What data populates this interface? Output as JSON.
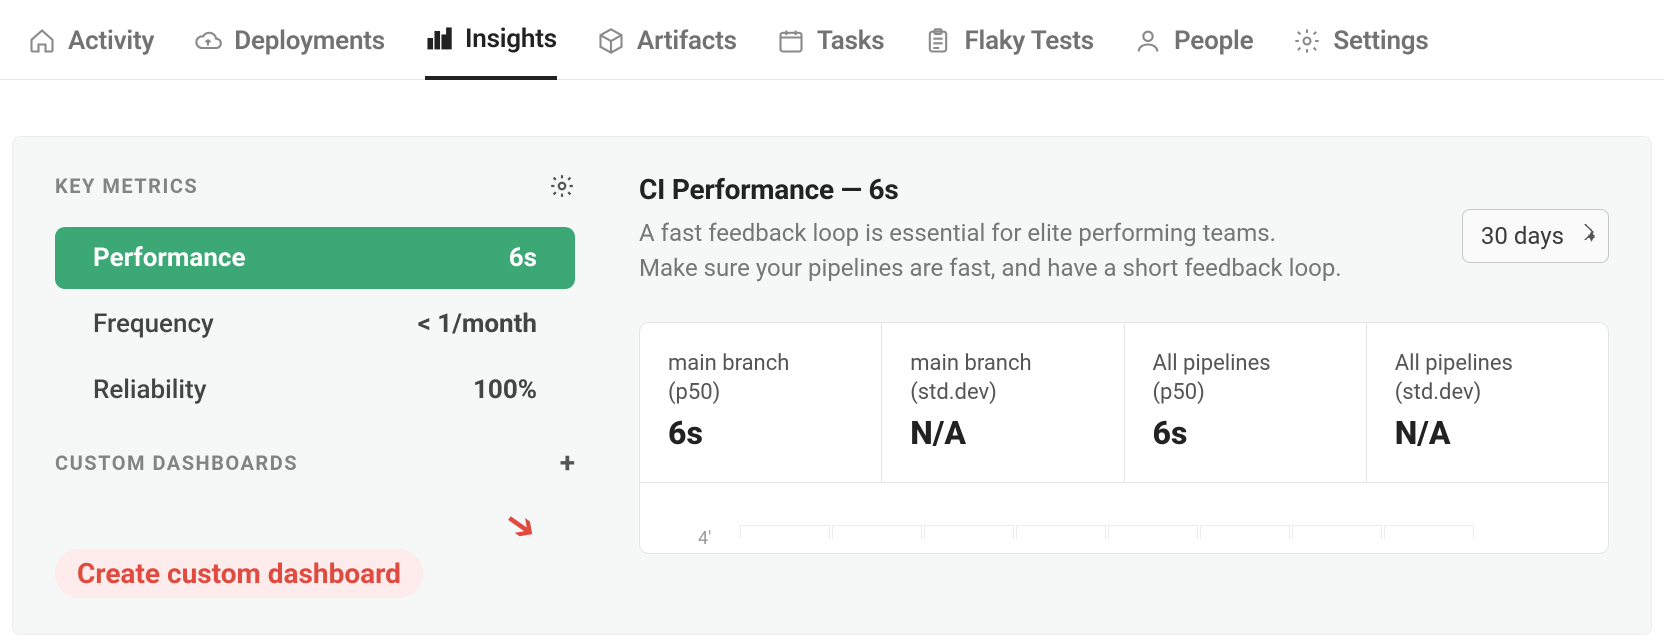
{
  "nav": [
    {
      "label": "Activity",
      "icon": "home-icon",
      "active": false
    },
    {
      "label": "Deployments",
      "icon": "cloud-icon",
      "active": false
    },
    {
      "label": "Insights",
      "icon": "bars-icon",
      "active": true
    },
    {
      "label": "Artifacts",
      "icon": "package-icon",
      "active": false
    },
    {
      "label": "Tasks",
      "icon": "calendar-icon",
      "active": false
    },
    {
      "label": "Flaky Tests",
      "icon": "clipboard-icon",
      "active": false
    },
    {
      "label": "People",
      "icon": "person-icon",
      "active": false
    },
    {
      "label": "Settings",
      "icon": "gear-icon",
      "active": false
    }
  ],
  "sidebar": {
    "key_metrics_title": "KEY METRICS",
    "metrics": [
      {
        "label": "Performance",
        "value": "6s",
        "active": true
      },
      {
        "label": "Frequency",
        "value": "< 1/month",
        "active": false
      },
      {
        "label": "Reliability",
        "value": "100%",
        "active": false
      }
    ],
    "custom_title": "CUSTOM DASHBOARDS",
    "callout": "Create custom dashboard"
  },
  "main": {
    "title": "CI Performance — 6s",
    "description_line1": "A fast feedback loop is essential for elite performing teams.",
    "description_line2": "Make sure your pipelines are fast, and have a short feedback loop.",
    "range_selected": "30 days",
    "stats": [
      {
        "label_line1": "main branch",
        "label_line2": "(p50)",
        "value": "6s"
      },
      {
        "label_line1": "main branch",
        "label_line2": "(std.dev)",
        "value": "N/A"
      },
      {
        "label_line1": "All pipelines",
        "label_line2": "(p50)",
        "value": "6s"
      },
      {
        "label_line1": "All pipelines",
        "label_line2": "(std.dev)",
        "value": "N/A"
      }
    ],
    "y_tick": "4'"
  }
}
